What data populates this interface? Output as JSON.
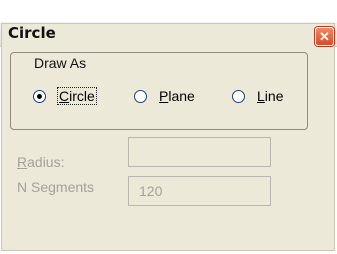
{
  "window": {
    "title": "Circle"
  },
  "draw_as": {
    "legend": "Draw As",
    "options": [
      {
        "label": "Circle",
        "selected": true
      },
      {
        "label": "Plane",
        "selected": false
      },
      {
        "label": "Line",
        "selected": false
      }
    ]
  },
  "fields": {
    "radius": {
      "label": "Radius:",
      "value": ""
    },
    "n_segments": {
      "label": "N Segments",
      "value": "120"
    }
  },
  "icons": {
    "close": "close-icon"
  }
}
